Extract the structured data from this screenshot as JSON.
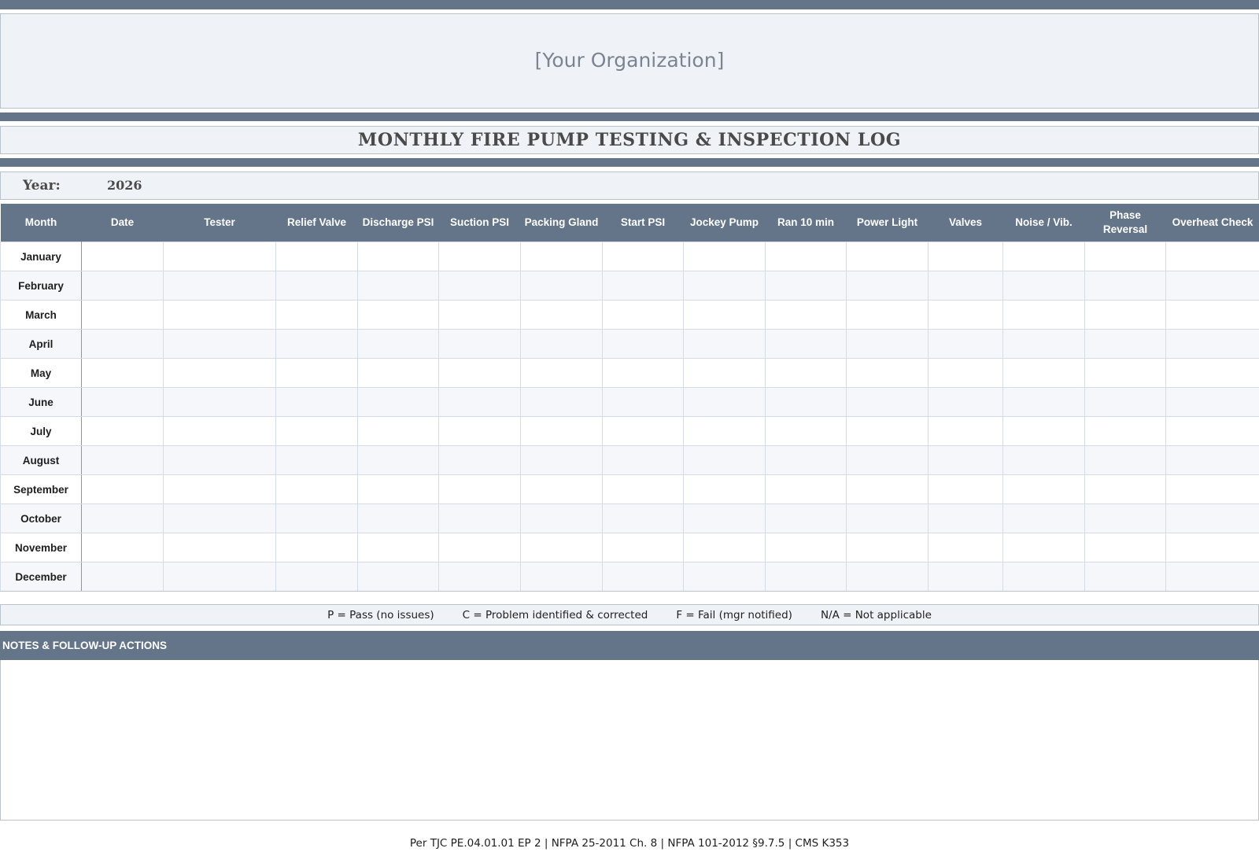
{
  "organization": "[Your Organization]",
  "title": "MONTHLY FIRE PUMP TESTING & INSPECTION LOG",
  "year": {
    "label": "Year:",
    "value": "2026"
  },
  "table": {
    "columns": [
      "Month",
      "Date",
      "Tester",
      "Relief Valve",
      "Discharge PSI",
      "Suction PSI",
      "Packing Gland",
      "Start PSI",
      "Jockey Pump",
      "Ran 10 min",
      "Power Light",
      "Valves",
      "Noise / Vib.",
      "Phase Reversal",
      "Overheat Check"
    ],
    "months": [
      "January",
      "February",
      "March",
      "April",
      "May",
      "June",
      "July",
      "August",
      "September",
      "October",
      "November",
      "December"
    ]
  },
  "legend": {
    "items": [
      "P = Pass (no issues)",
      "C = Problem identified & corrected",
      "F = Fail (mgr notified)",
      "N/A = Not applicable"
    ]
  },
  "notes": {
    "title": "NOTES & FOLLOW-UP ACTIONS"
  },
  "footer": "Per TJC PE.04.01.01 EP 2  |  NFPA 25-2011 Ch. 8  |  NFPA 101-2012 §9.7.5  |  CMS K353",
  "colors": {
    "header_band": "#647489",
    "panel_bg": "#eff3f8",
    "row_alt": "#f5f7fa"
  }
}
